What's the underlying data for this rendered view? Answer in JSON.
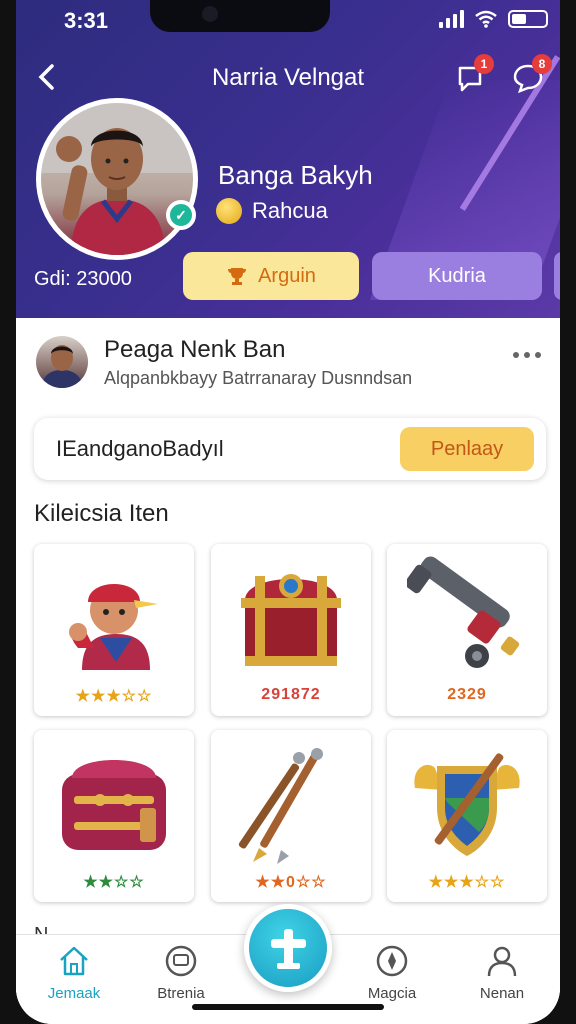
{
  "status": {
    "time": "3:31"
  },
  "header": {
    "title": "Narria Velngat",
    "notifications_badge": "1",
    "messages_badge": "8",
    "profile_name": "Banga Bakyh",
    "rank_label": "Rahcua",
    "gold_label": "Gdi: 23000",
    "primary_button": "Arguin",
    "secondary_button": "Kudria"
  },
  "post": {
    "name": "Peaga Nenk Ban",
    "subtitle": "Alqpanbkbayy Batrranaray Dusnndsan"
  },
  "search": {
    "text": "IEandganoBadyıl",
    "button_label": "Penlaay"
  },
  "items_section": {
    "title": "Kileicsia  Iten",
    "items": [
      {
        "icon": "player-figurine-icon",
        "rating_text": "★★★☆☆",
        "rating": 3
      },
      {
        "icon": "treasure-chest-icon",
        "rating_text": "291872"
      },
      {
        "icon": "cannon-icon",
        "rating_text": "2329"
      },
      {
        "icon": "backpack-icon",
        "rating_text": "★★☆☆",
        "rating": 2
      },
      {
        "icon": "arrows-icon",
        "rating_text": "★★0☆☆"
      },
      {
        "icon": "shield-emblem-icon",
        "rating_text": "★★★☆☆",
        "rating": 3
      }
    ],
    "peek_text": "N"
  },
  "bottom_nav": {
    "items": [
      {
        "label": "Jemaak",
        "icon": "home-icon",
        "active": true
      },
      {
        "label": "Btrenia",
        "icon": "tv-icon"
      },
      {
        "label": "Magcia",
        "icon": "compass-icon"
      },
      {
        "label": "Nenan",
        "icon": "profile-icon"
      }
    ],
    "fab_icon": "plus-icon"
  },
  "colors": {
    "header_gradient_start": "#2d2c7e",
    "header_gradient_end": "#5b3aa8",
    "accent_yellow": "#f7cf62",
    "accent_purple": "#9a7fe0",
    "fab_teal": "#1a9cc2"
  }
}
